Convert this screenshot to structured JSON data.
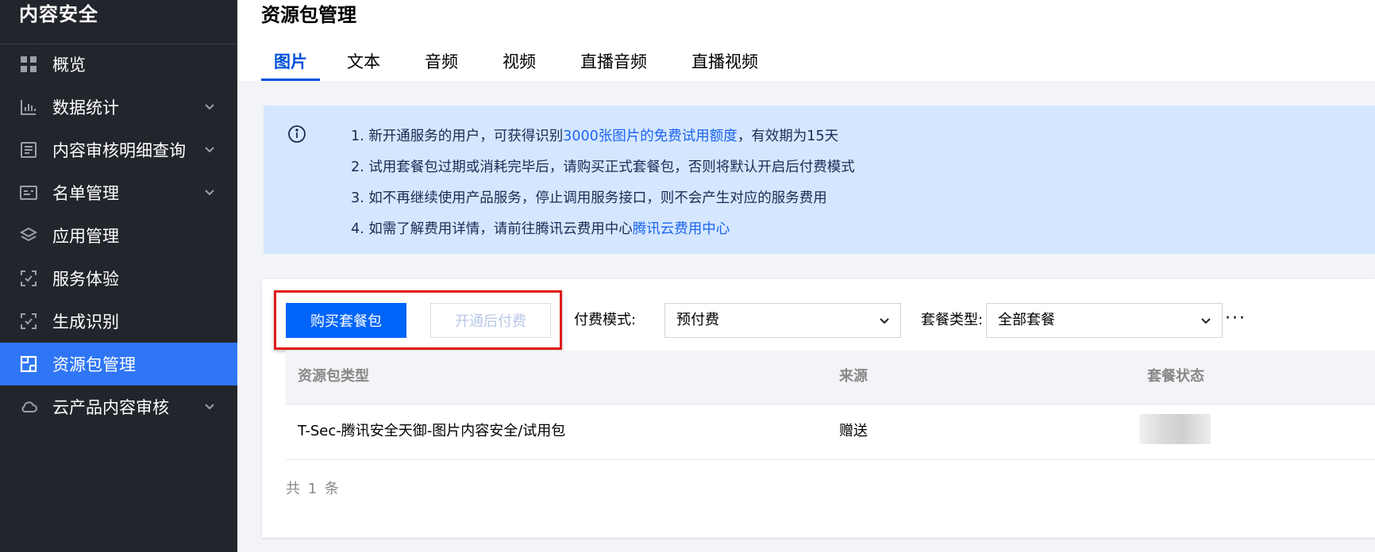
{
  "sidebar": {
    "brand": "内容安全",
    "items": [
      {
        "label": "概览",
        "icon": "grid-icon",
        "has_chevron": false,
        "active": false
      },
      {
        "label": "数据统计",
        "icon": "bar-chart-icon",
        "has_chevron": true,
        "active": false
      },
      {
        "label": "内容审核明细查询",
        "icon": "document-list-icon",
        "has_chevron": true,
        "active": false
      },
      {
        "label": "名单管理",
        "icon": "id-card-icon",
        "has_chevron": true,
        "active": false
      },
      {
        "label": "应用管理",
        "icon": "layers-icon",
        "has_chevron": false,
        "active": false
      },
      {
        "label": "服务体验",
        "icon": "scan-check-icon",
        "has_chevron": false,
        "active": false
      },
      {
        "label": "生成识别",
        "icon": "scan-check-icon",
        "has_chevron": false,
        "active": false
      },
      {
        "label": "资源包管理",
        "icon": "package-icon",
        "has_chevron": false,
        "active": true
      },
      {
        "label": "云产品内容审核",
        "icon": "cloud-icon",
        "has_chevron": true,
        "active": false
      }
    ]
  },
  "header": {
    "title": "资源包管理",
    "tabs": [
      "图片",
      "文本",
      "音频",
      "视频",
      "直播音频",
      "直播视频"
    ],
    "active_tab": "图片"
  },
  "notice": {
    "line1_prefix": "1. 新开通服务的用户，可获得识别",
    "line1_highlight": "3000张图片的免费试用额度",
    "line1_suffix": "，有效期为15天",
    "line2": "2. 试用套餐包过期或消耗完毕后，请购买正式套餐包，否则将默认开启后付费模式",
    "line3": "3. 如不再继续使用产品服务，停止调用服务接口，则不会产生对应的服务费用",
    "line4_prefix": "4. 如需了解费用详情，请前往腾讯云费用中心",
    "line4_link": "腾讯云费用中心"
  },
  "toolbar": {
    "buy_label": "购买套餐包",
    "postpaid_label": "开通后付费",
    "pay_mode_label": "付费模式:",
    "pay_mode_value": "预付费",
    "package_type_label": "套餐类型:",
    "package_type_value": "全部套餐",
    "more": "···"
  },
  "table": {
    "headers": [
      "资源包类型",
      "来源",
      "套餐状态"
    ],
    "rows": [
      {
        "type": "T-Sec-腾讯安全天御-图片内容安全/试用包",
        "source": "赠送",
        "status": ""
      }
    ],
    "total": "共 1 条"
  },
  "colors": {
    "sidebar_bg": "#22252b",
    "active_nav": "#2f76f6",
    "primary": "#0064fa",
    "notice_bg": "#d5e7ff",
    "highlight_border": "#e01a1a"
  }
}
